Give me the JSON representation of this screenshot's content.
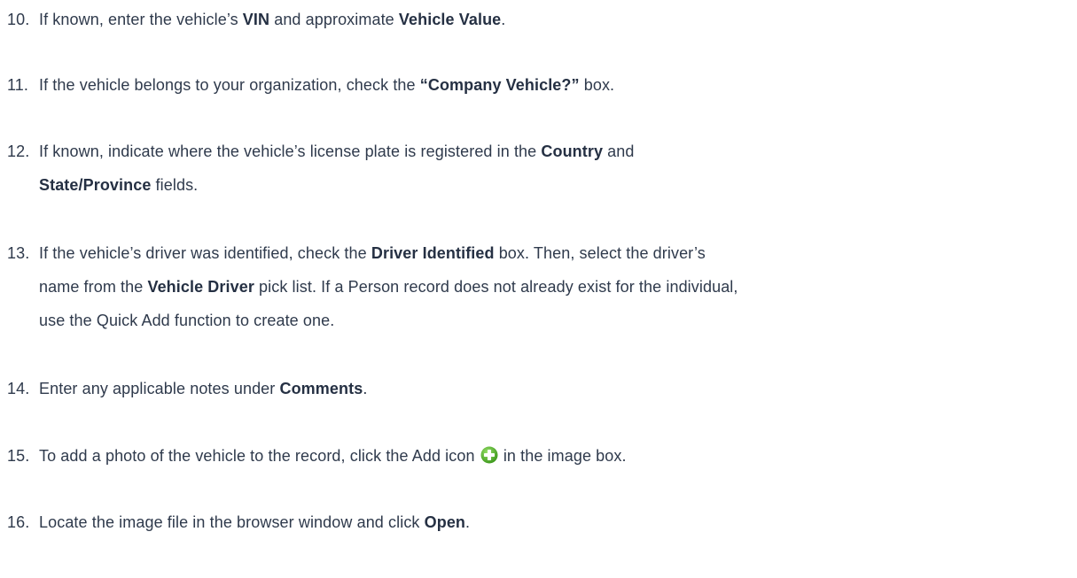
{
  "steps": [
    {
      "num": "10.",
      "parts": [
        "If known, enter the vehicle’s ",
        "VIN",
        " and approximate ",
        "Vehicle Value",
        "."
      ]
    },
    {
      "num": "11.",
      "parts": [
        "If the vehicle belongs to your organization, check the ",
        "“Company Vehicle?”",
        " box."
      ]
    },
    {
      "num": "12.",
      "line1": [
        "If known, indicate where the vehicle’s license plate is registered in the ",
        "Country",
        " and"
      ],
      "line2": [
        "State/Province",
        " fields."
      ]
    },
    {
      "num": "13.",
      "line1": [
        "If the vehicle’s driver was identified, check the ",
        "Driver Identified",
        " box. Then, select the driver’s"
      ],
      "line2": [
        "name from the ",
        "Vehicle Driver",
        " pick list. If a Person record does not already exist for the individual,"
      ],
      "line3": "use the Quick Add function to create one."
    },
    {
      "num": "14.",
      "parts": [
        "Enter any applicable notes under ",
        "Comments",
        "."
      ]
    },
    {
      "num": "15.",
      "parts": [
        "To add a photo of the vehicle to the record, click the Add icon ",
        " in the image box."
      ],
      "icon": "add-plus-icon",
      "icon_color": "#5cb531"
    },
    {
      "num": "16.",
      "parts": [
        "Locate the image file in the browser window and click ",
        "Open",
        "."
      ]
    }
  ],
  "colors": {
    "text": "#2f3a4c",
    "bold": "#253043",
    "add_icon": "#5cb531"
  }
}
